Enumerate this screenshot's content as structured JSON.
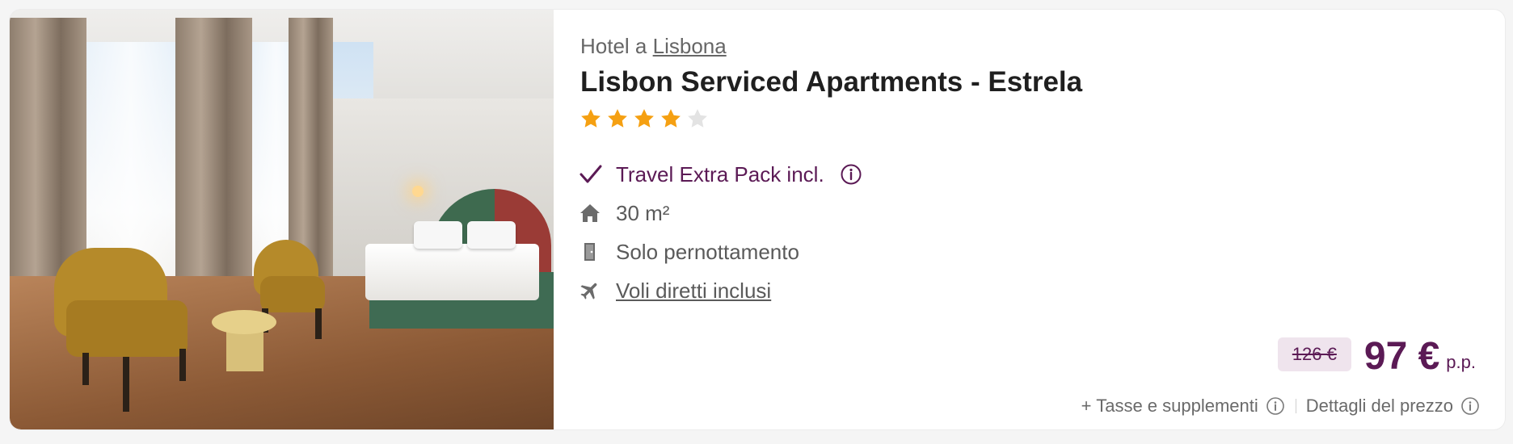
{
  "listing": {
    "category_prefix": "Hotel a",
    "city_link": "Lisbona",
    "name": "Lisbon Serviced Apartments - Estrela",
    "rating": {
      "stars": 4,
      "max": 5,
      "filled_color": "#f5a012",
      "empty_color": "#e3e3e3"
    },
    "photo_icon": "hotel-room-photo"
  },
  "features": [
    {
      "icon": "check-icon",
      "label": "Travel Extra Pack incl.",
      "has_info": true,
      "info_icon": "info-icon"
    },
    {
      "icon": "home-icon",
      "label": "30 m²"
    },
    {
      "icon": "door-icon",
      "label": "Solo pernottamento"
    },
    {
      "icon": "plane-icon",
      "label": "Voli diretti inclusi",
      "link": true
    }
  ],
  "price": {
    "old": "126 €",
    "current": "97 €",
    "unit": "p.p.",
    "color": "#5b1a55"
  },
  "extras": {
    "taxes_label": "+ Tasse e supplementi",
    "details_label": "Dettagli del prezzo"
  }
}
